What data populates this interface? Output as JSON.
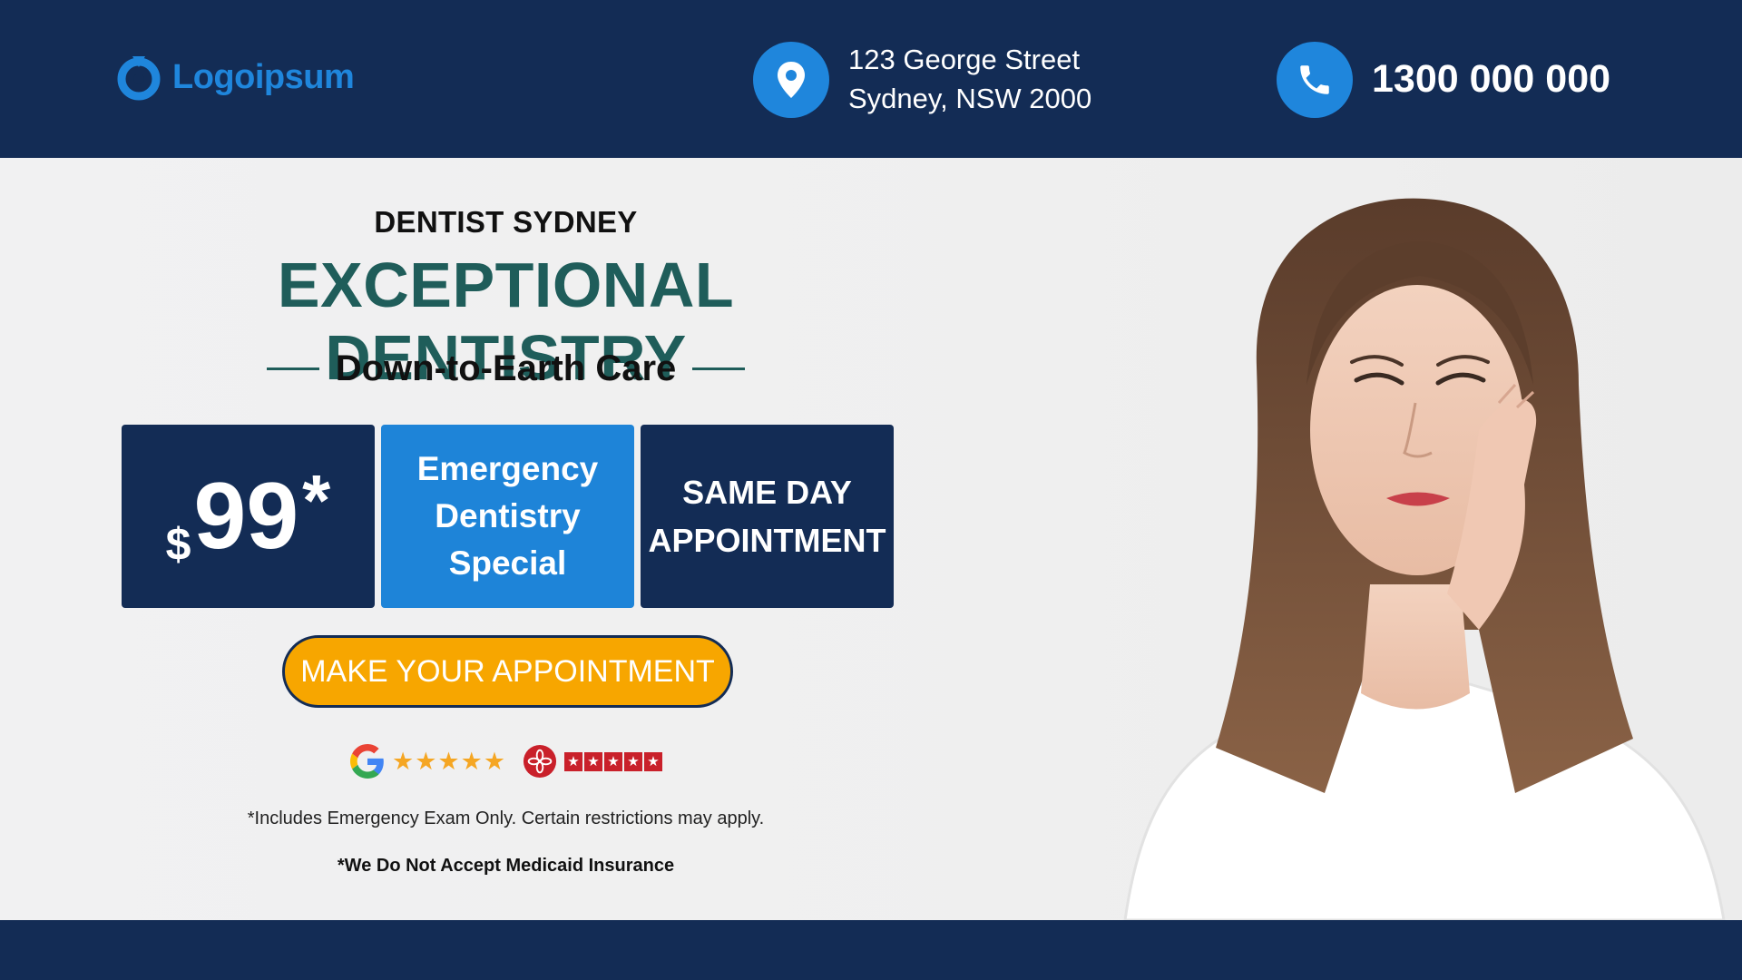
{
  "header": {
    "logo": {
      "text": "Logoipsum",
      "icon": "logo-ring-icon"
    },
    "address": {
      "icon": "location-pin-icon",
      "line1": "123 George Street",
      "line2": "Sydney, NSW 2000"
    },
    "phone": {
      "icon": "phone-icon",
      "number": "1300 000 000"
    }
  },
  "hero": {
    "eyebrow": "DENTIST SYDNEY",
    "headline": "EXCEPTIONAL DENTISTRY",
    "tagline": "Down-to-Earth Care",
    "offer": {
      "currency": "$",
      "amount": "99",
      "asterisk": "*",
      "special_line1": "Emergency",
      "special_line2": "Dentistry",
      "special_line3": "Special",
      "sameday_line1": "SAME DAY",
      "sameday_line2": "APPOINTMENT"
    },
    "cta_label": "MAKE YOUR APPOINTMENT",
    "ratings": {
      "google": {
        "icon": "google-icon",
        "stars": "★★★★★",
        "value": 5
      },
      "yelp": {
        "icon": "yelp-icon",
        "star_glyph": "★",
        "value": 5
      }
    },
    "disclaimer1": "*Includes Emergency Exam Only. Certain restrictions may apply.",
    "disclaimer2": "*We Do Not Accept Medicaid Insurance",
    "photo": {
      "icon": "woman-toothache-photo"
    }
  },
  "colors": {
    "navy": "#132c55",
    "brand_blue": "#1f86dc",
    "teal": "#1f5d5a",
    "cta_orange": "#f7a600",
    "google_star": "#f5a623",
    "yelp_red": "#c9202a"
  }
}
